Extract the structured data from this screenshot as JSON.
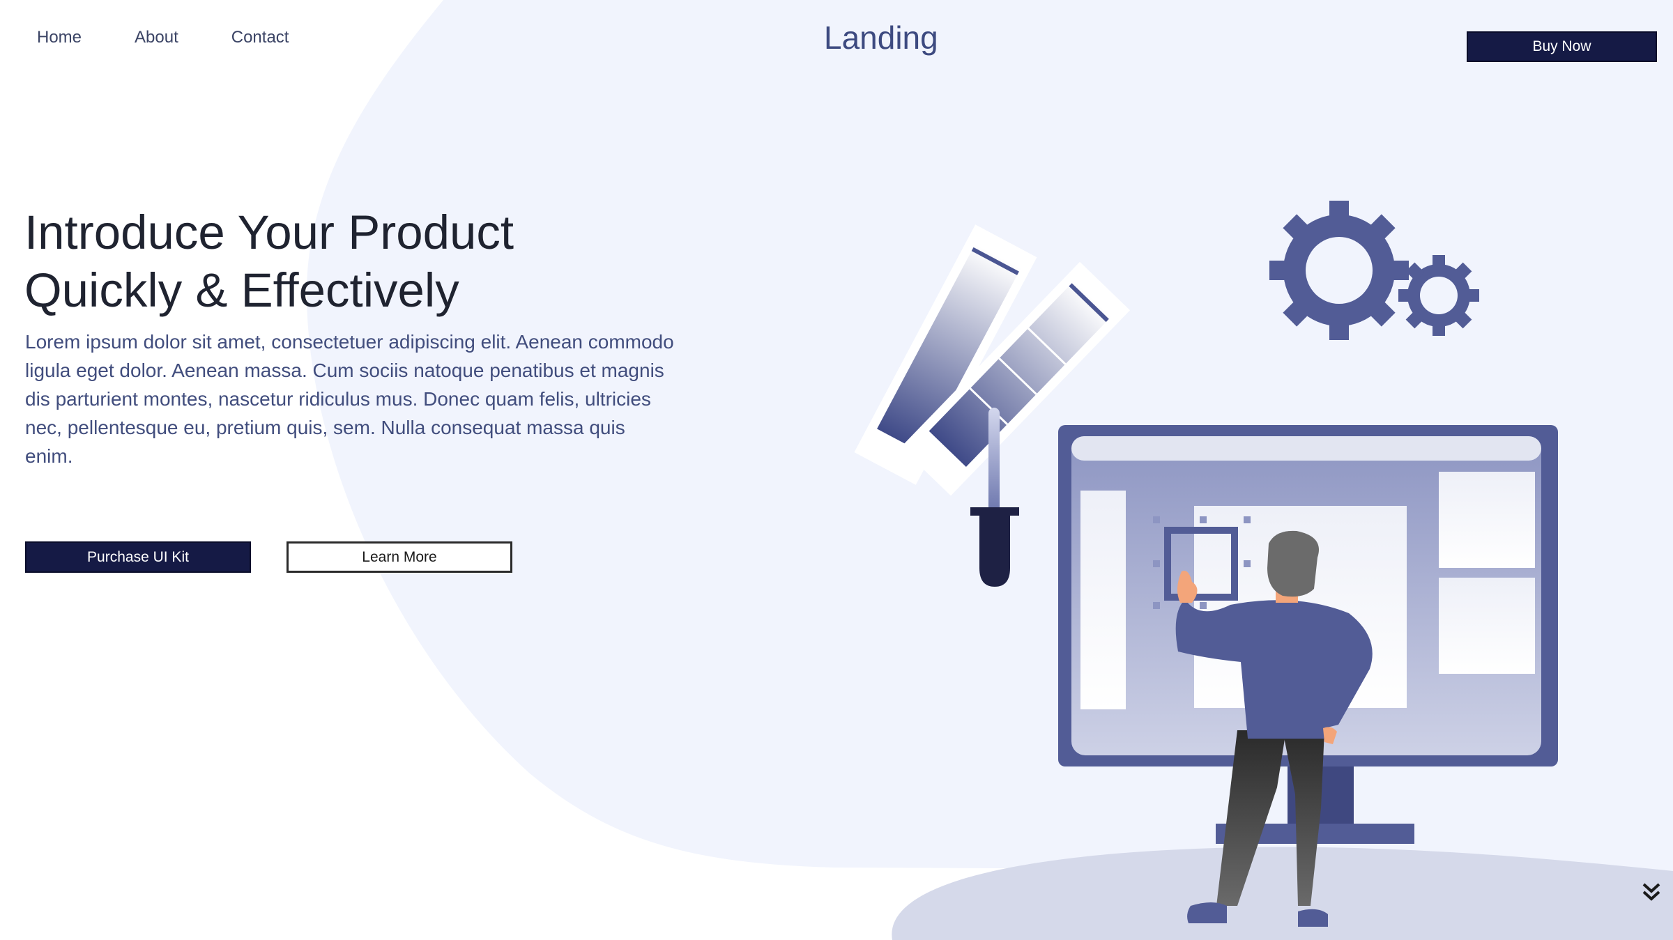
{
  "nav": {
    "items": [
      {
        "label": "Home"
      },
      {
        "label": "About"
      },
      {
        "label": "Contact"
      }
    ]
  },
  "brand": {
    "title": "Landing"
  },
  "header": {
    "buy_label": "Buy Now"
  },
  "hero": {
    "title_line1": "Introduce Your Product",
    "title_line2": "Quickly & Effectively",
    "body": "Lorem ipsum dolor sit amet, consectetuer adipiscing elit. Aenean commodo ligula eget dolor. Aenean massa. Cum sociis natoque penatibus et magnis dis parturient montes, nascetur ridiculus mus. Donec quam felis, ultricies nec, pellentesque eu, pretium quis, sem. Nulla consequat massa quis enim.",
    "primary_label": "Purchase UI Kit",
    "secondary_label": "Learn More"
  },
  "icons": {
    "scroll": "double-chevron-down-icon"
  },
  "colors": {
    "accent": "#151a45",
    "blob": "#f1f4fd",
    "illustration": "#525c96",
    "text": "#414d7d"
  }
}
